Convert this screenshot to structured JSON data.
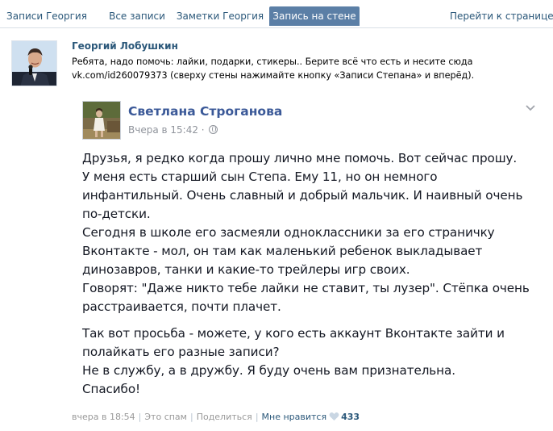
{
  "tabs": [
    {
      "label": "Записи Георгия"
    },
    {
      "label": "Все записи"
    },
    {
      "label": "Заметки Георгия"
    },
    {
      "label": "Запись на стене",
      "active": true
    },
    {
      "label": "Перейти к странице"
    }
  ],
  "post": {
    "author": "Георгий Лобушкин",
    "text_lines": [
      "Ребята, надо помочь: лайки, подарки, стикеры.. Берите всё что есть и несите сюда",
      "vk.com/id260079373 (сверху стены нажимайте кнопку «Записи Степана» и вперёд)."
    ]
  },
  "fb_post": {
    "author": "Светлана Строганова",
    "time": "Вчера в 15:42",
    "dot": " · ",
    "paragraph1": [
      "Друзья, я редко когда прошу лично мне помочь. Вот сейчас прошу.",
      "У меня есть старший сын Степа. Ему 11, но он немного",
      "инфантильный. Очень славный и добрый мальчик. И наивный очень",
      "по-детски.",
      "Сегодня в школе его засмеяли одноклассники за его страничку",
      "Вконтакте - мол, он там как маленький ребенок выкладывает",
      "динозавров, танки и какие-то трейлеры игр своих.",
      "Говорят: \"Даже никто тебе лайки не ставит, ты лузер\". Стёпка очень",
      "расстраивается, почти плачет."
    ],
    "paragraph2": [
      "Так вот просьба - можете, у кого есть аккаунт Вконтакте зайти и",
      "полайкать его разные записи?",
      "Не в службу, а в дружбу. Я буду очень вам признательна.",
      "Спасибо!"
    ]
  },
  "footer": {
    "time": "вчера в 18:54",
    "sep": "|",
    "spam": "Это спам",
    "share": "Поделиться",
    "like_label": "Мне нравится",
    "like_count": "433"
  },
  "colors": {
    "vk_link": "#2b587a",
    "vk_active_tab": "#5b7fa6",
    "fb_name": "#3b5998",
    "fb_meta": "#90949c"
  }
}
